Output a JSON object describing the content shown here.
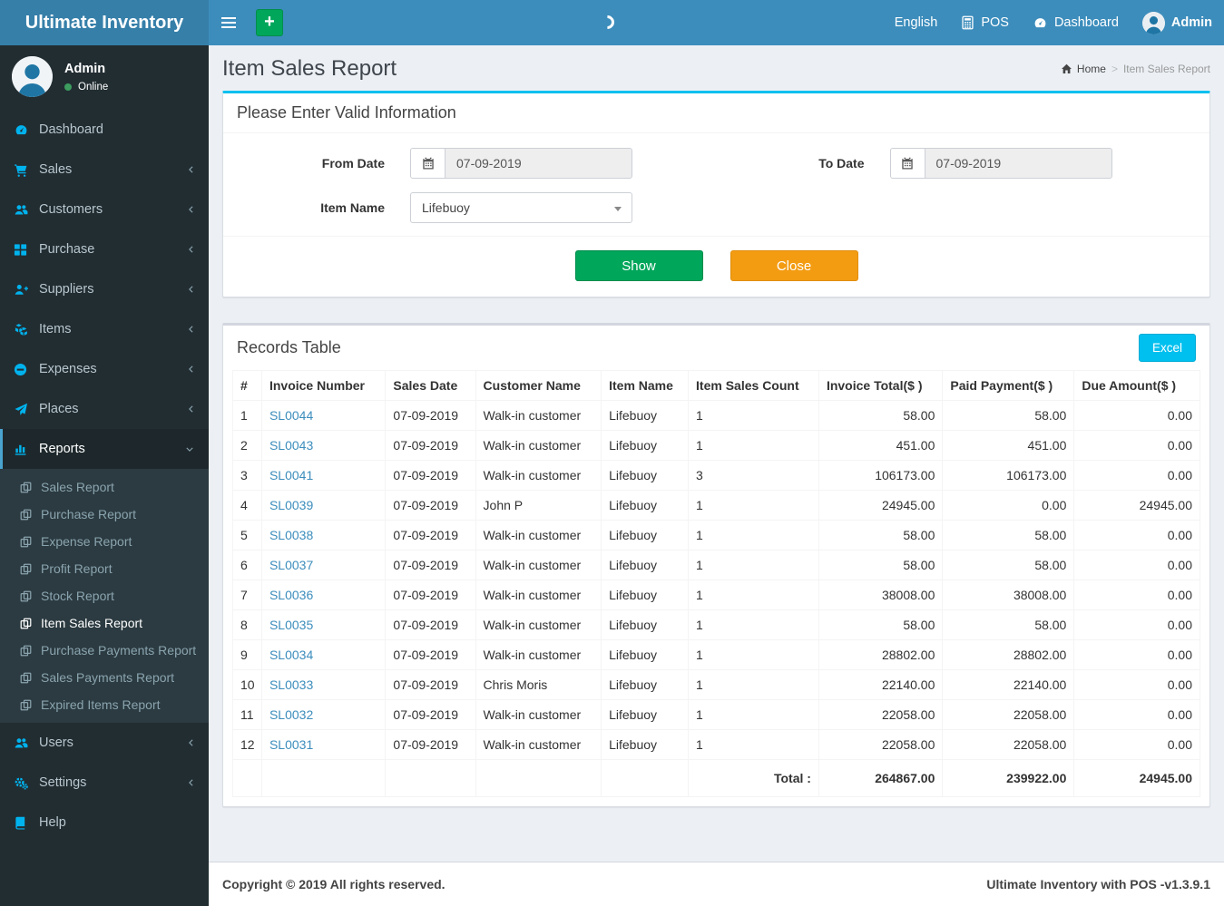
{
  "colors": {
    "navbar": "#3c8dbc",
    "logo_bg": "#367fa9",
    "sidebar_bg": "#222d32",
    "sidebar_icon": "#00b3ee",
    "accent_cyan": "#00c0ef",
    "green": "#00a65a",
    "orange": "#f39c12",
    "link": "#3c8dbc"
  },
  "navbar": {
    "brand": "Ultimate Inventory",
    "plus_label": "+",
    "menu": {
      "language": "English",
      "pos": "POS",
      "dashboard": "Dashboard",
      "user": "Admin"
    }
  },
  "sidebar": {
    "user": {
      "name": "Admin",
      "status": "Online"
    },
    "items": [
      {
        "label": "Dashboard"
      },
      {
        "label": "Sales"
      },
      {
        "label": "Customers"
      },
      {
        "label": "Purchase"
      },
      {
        "label": "Suppliers"
      },
      {
        "label": "Items"
      },
      {
        "label": "Expenses"
      },
      {
        "label": "Places"
      },
      {
        "label": "Reports"
      },
      {
        "label": "Users"
      },
      {
        "label": "Settings"
      },
      {
        "label": "Help"
      }
    ],
    "reports_children": [
      "Sales Report",
      "Purchase Report",
      "Expense Report",
      "Profit Report",
      "Stock Report",
      "Item Sales Report",
      "Purchase Payments Report",
      "Sales Payments Report",
      "Expired Items Report"
    ],
    "active_item": "Reports",
    "active_child": "Item Sales Report"
  },
  "page": {
    "title": "Item Sales Report",
    "breadcrumb": {
      "home": "Home",
      "current": "Item Sales Report"
    }
  },
  "filter": {
    "title": "Please Enter Valid Information",
    "from_label": "From Date",
    "from_value": "07-09-2019",
    "to_label": "To Date",
    "to_value": "07-09-2019",
    "item_label": "Item Name",
    "item_value": "Lifebuoy",
    "show_label": "Show",
    "close_label": "Close"
  },
  "records": {
    "title": "Records Table",
    "excel_label": "Excel",
    "columns": [
      "#",
      "Invoice Number",
      "Sales Date",
      "Customer Name",
      "Item Name",
      "Item Sales Count",
      "Invoice Total($ )",
      "Paid Payment($ )",
      "Due Amount($ )"
    ],
    "rows": [
      [
        "1",
        "SL0044",
        "07-09-2019",
        "Walk-in customer",
        "Lifebuoy",
        "1",
        "58.00",
        "58.00",
        "0.00"
      ],
      [
        "2",
        "SL0043",
        "07-09-2019",
        "Walk-in customer",
        "Lifebuoy",
        "1",
        "451.00",
        "451.00",
        "0.00"
      ],
      [
        "3",
        "SL0041",
        "07-09-2019",
        "Walk-in customer",
        "Lifebuoy",
        "3",
        "106173.00",
        "106173.00",
        "0.00"
      ],
      [
        "4",
        "SL0039",
        "07-09-2019",
        "John P",
        "Lifebuoy",
        "1",
        "24945.00",
        "0.00",
        "24945.00"
      ],
      [
        "5",
        "SL0038",
        "07-09-2019",
        "Walk-in customer",
        "Lifebuoy",
        "1",
        "58.00",
        "58.00",
        "0.00"
      ],
      [
        "6",
        "SL0037",
        "07-09-2019",
        "Walk-in customer",
        "Lifebuoy",
        "1",
        "58.00",
        "58.00",
        "0.00"
      ],
      [
        "7",
        "SL0036",
        "07-09-2019",
        "Walk-in customer",
        "Lifebuoy",
        "1",
        "38008.00",
        "38008.00",
        "0.00"
      ],
      [
        "8",
        "SL0035",
        "07-09-2019",
        "Walk-in customer",
        "Lifebuoy",
        "1",
        "58.00",
        "58.00",
        "0.00"
      ],
      [
        "9",
        "SL0034",
        "07-09-2019",
        "Walk-in customer",
        "Lifebuoy",
        "1",
        "28802.00",
        "28802.00",
        "0.00"
      ],
      [
        "10",
        "SL0033",
        "07-09-2019",
        "Chris Moris",
        "Lifebuoy",
        "1",
        "22140.00",
        "22140.00",
        "0.00"
      ],
      [
        "11",
        "SL0032",
        "07-09-2019",
        "Walk-in customer",
        "Lifebuoy",
        "1",
        "22058.00",
        "22058.00",
        "0.00"
      ],
      [
        "12",
        "SL0031",
        "07-09-2019",
        "Walk-in customer",
        "Lifebuoy",
        "1",
        "22058.00",
        "22058.00",
        "0.00"
      ]
    ],
    "total": {
      "label": "Total :",
      "invoice_total": "264867.00",
      "paid_payment": "239922.00",
      "due_amount": "24945.00"
    }
  },
  "footer": {
    "left": "Copyright © 2019 All rights reserved.",
    "right": "Ultimate Inventory with POS -v1.3.9.1"
  }
}
